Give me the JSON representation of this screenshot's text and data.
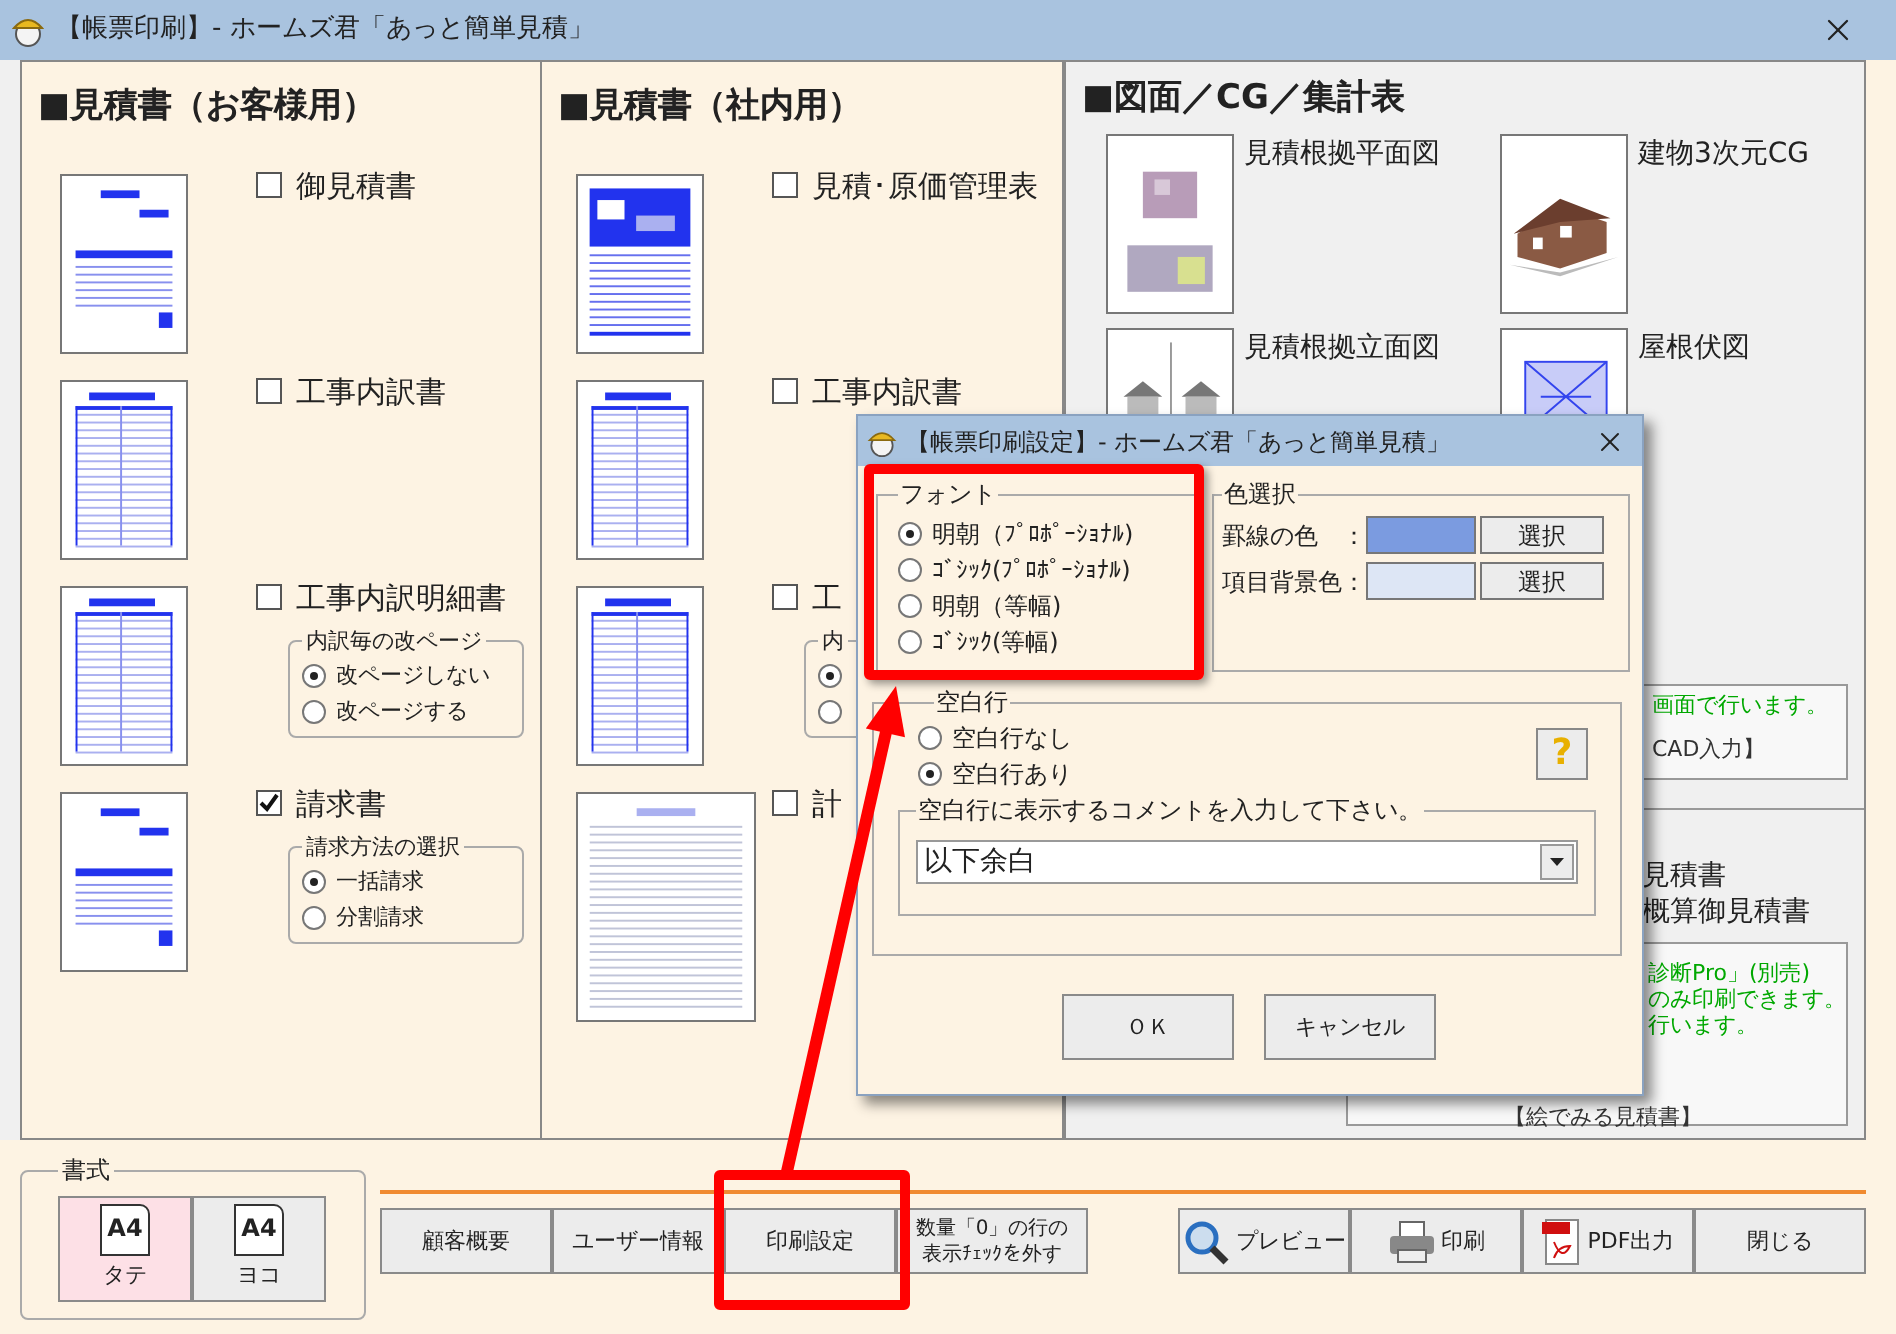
{
  "window": {
    "title": "【帳票印刷】- ホームズ君「あっと簡単見積」"
  },
  "customer_section": {
    "heading": "■見積書（お客様用）",
    "items": [
      {
        "label": "御見積書",
        "checked": false,
        "kind": "form"
      },
      {
        "label": "工事内訳書",
        "checked": false,
        "kind": "table"
      },
      {
        "label": "工事内訳明細書",
        "checked": false,
        "kind": "table",
        "option_group": {
          "title": "内訳毎の改ページ",
          "options": [
            {
              "label": "改ページしない",
              "selected": true
            },
            {
              "label": "改ページする",
              "selected": false
            }
          ]
        }
      },
      {
        "label": "請求書",
        "checked": true,
        "kind": "form",
        "option_group": {
          "title": "請求方法の選択",
          "options": [
            {
              "label": "一括請求",
              "selected": true
            },
            {
              "label": "分割請求",
              "selected": false
            }
          ]
        }
      }
    ]
  },
  "internal_section": {
    "heading": "■見積書（社内用）",
    "items": [
      {
        "label": "見積･原価管理表",
        "checked": false,
        "kind": "dense"
      },
      {
        "label": "工事内訳書",
        "checked": false,
        "kind": "table"
      },
      {
        "label": "工",
        "checked": false,
        "kind": "table",
        "option_group": {
          "title": "内",
          "options": [
            {
              "selected": true
            },
            {
              "selected": false
            }
          ]
        }
      },
      {
        "label": "計",
        "checked": false,
        "kind": "wide"
      }
    ]
  },
  "drawings_section": {
    "heading": "■図面／CG／集計表",
    "items": [
      {
        "label": "見積根拠平面図",
        "kind": "floor-plan"
      },
      {
        "label": "建物3次元CG",
        "kind": "house"
      },
      {
        "label": "見積根拠立面図",
        "kind": "elevation"
      },
      {
        "label": "屋根伏図",
        "kind": "roof"
      }
    ],
    "note_top": {
      "lines": [
        {
          "text": "画面で行います。",
          "color": "#00a800"
        },
        {
          "text": "CAD入力】",
          "color": "#333333"
        }
      ]
    },
    "titles": [
      "見積書",
      "概算御見積書"
    ],
    "note_bottom": {
      "lines": [
        {
          "text": "診断Pro」(別売)",
          "color": "#00a800"
        },
        {
          "text": "のみ印刷できます。",
          "color": "#00a800"
        },
        {
          "text": "行います。",
          "color": "#00a800"
        },
        {
          "text": "【絵でみる見積書】",
          "color": "#333333"
        }
      ]
    }
  },
  "format_group": {
    "title": "書式",
    "options": [
      {
        "label": "A4",
        "sublabel": "タテ",
        "selected": true
      },
      {
        "label": "A4",
        "sublabel": "ヨコ",
        "selected": false
      }
    ]
  },
  "toolbar_left": [
    "顧客概要",
    "ユーザー情報",
    "印刷設定",
    "数量「0」の行の表示ﾁｪｯｸを外す"
  ],
  "toolbar_right": [
    {
      "label": "プレビュー",
      "kind": "preview"
    },
    {
      "label": "印刷",
      "kind": "print"
    },
    {
      "label": "PDF出力",
      "kind": "pdf"
    },
    {
      "label": "閉じる",
      "kind": "plain"
    }
  ],
  "dialog": {
    "title": "【帳票印刷設定】- ホームズ君「あっと簡単見積」",
    "font_group": {
      "title": "フォント",
      "options": [
        {
          "label": "明朝（ﾌﾟﾛﾎﾟｰｼｮﾅﾙ)",
          "selected": true
        },
        {
          "label": "ｺﾞｼｯｸ(ﾌﾟﾛﾎﾟｰｼｮﾅﾙ)",
          "selected": false
        },
        {
          "label": "明朝（等幅)",
          "selected": false
        },
        {
          "label": "ｺﾞｼｯｸ(等幅)",
          "selected": false
        }
      ]
    },
    "color_group": {
      "title": "色選択",
      "rows": [
        {
          "label": "罫線の色　：",
          "color": "#7b9be0",
          "button": "選択"
        },
        {
          "label": "項目背景色：",
          "color": "#dde6f5",
          "button": "選択"
        }
      ]
    },
    "blank_group": {
      "title": "空白行",
      "options": [
        {
          "label": "空白行なし",
          "selected": false
        },
        {
          "label": "空白行あり",
          "selected": true
        }
      ],
      "help": "?",
      "comment_group": {
        "title": "空白行に表示するコメントを入力して下さい。",
        "value": "以下余白"
      }
    },
    "buttons": [
      "ＯＫ",
      "キャンセル"
    ]
  }
}
